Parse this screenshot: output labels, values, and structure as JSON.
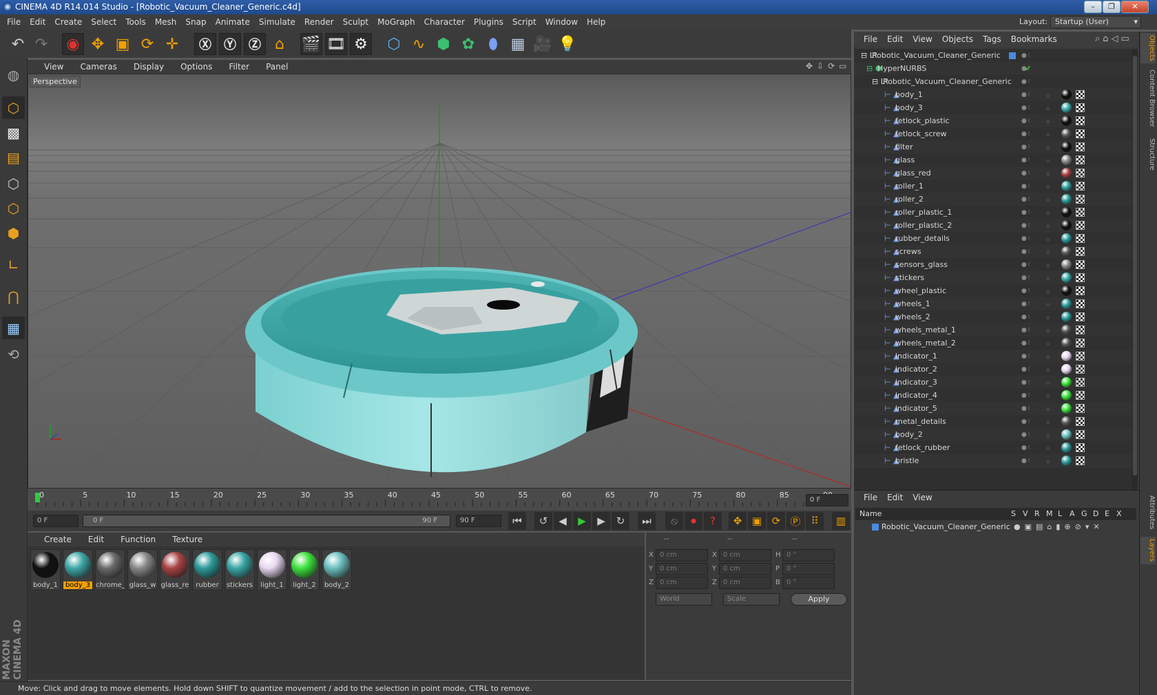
{
  "window": {
    "title": "CINEMA 4D R14.014 Studio - [Robotic_Vacuum_Cleaner_Generic.c4d]"
  },
  "menubar": [
    "File",
    "Edit",
    "Create",
    "Select",
    "Tools",
    "Mesh",
    "Snap",
    "Animate",
    "Simulate",
    "Render",
    "Sculpt",
    "MoGraph",
    "Character",
    "Plugins",
    "Script",
    "Window",
    "Help"
  ],
  "layout": {
    "label": "Layout:",
    "value": "Startup (User)"
  },
  "viewport": {
    "menu": [
      "View",
      "Cameras",
      "Display",
      "Options",
      "Filter",
      "Panel"
    ],
    "label": "Perspective"
  },
  "timeline": {
    "ticks": [
      "0",
      "5",
      "10",
      "15",
      "20",
      "25",
      "30",
      "35",
      "40",
      "45",
      "50",
      "55",
      "60",
      "65",
      "70",
      "75",
      "80",
      "85",
      "90"
    ],
    "current_frame": "0 F",
    "start_field": "0 F",
    "range_start": "0 F",
    "range_end": "90 F",
    "end_field": "90 F"
  },
  "materials": {
    "menu": [
      "Create",
      "Edit",
      "Function",
      "Texture"
    ],
    "items": [
      {
        "label": "body_1",
        "color": "#111111"
      },
      {
        "label": "body_3",
        "color": "#3fa8a8",
        "selected": true
      },
      {
        "label": "chrome_",
        "color": "#6a6a6a"
      },
      {
        "label": "glass_w",
        "color": "#888888"
      },
      {
        "label": "glass_re",
        "color": "#a84444"
      },
      {
        "label": "rubber",
        "color": "#2e9a9a"
      },
      {
        "label": "stickers",
        "color": "#3aa6a6"
      },
      {
        "label": "light_1",
        "color": "#e8d8f0"
      },
      {
        "label": "light_2",
        "color": "#3de23d"
      },
      {
        "label": "body_2",
        "color": "#6cc0c0"
      }
    ]
  },
  "coords": {
    "headers": [
      "--",
      "--",
      "--"
    ],
    "rows": [
      {
        "a": "X",
        "av": "0 cm",
        "b": "X",
        "bv": "0 cm",
        "c": "H",
        "cv": "0 °"
      },
      {
        "a": "Y",
        "av": "0 cm",
        "b": "Y",
        "bv": "0 cm",
        "c": "P",
        "cv": "0 °"
      },
      {
        "a": "Z",
        "av": "0 cm",
        "b": "Z",
        "bv": "0 cm",
        "c": "B",
        "cv": "0 °"
      }
    ],
    "world": "World",
    "scale": "Scale",
    "apply": "Apply"
  },
  "status": "Move: Click and drag to move elements. Hold down SHIFT to quantize movement / add to the selection in point mode, CTRL to remove.",
  "objects": {
    "menu": [
      "File",
      "Edit",
      "View",
      "Objects",
      "Tags",
      "Bookmarks"
    ],
    "root": "Robotic_Vacuum_Cleaner_Generic",
    "hypernurbs": "HyperNURBS",
    "group": "Robotic_Vacuum_Cleaner_Generic",
    "items": [
      {
        "name": "body_1",
        "color": "#111111"
      },
      {
        "name": "body_3",
        "color": "#3fa8a8"
      },
      {
        "name": "fetlock_plastic",
        "color": "#111111"
      },
      {
        "name": "fetlock_screw",
        "color": "#555555"
      },
      {
        "name": "filter",
        "color": "#111111"
      },
      {
        "name": "glass",
        "color": "#888888"
      },
      {
        "name": "glass_red",
        "color": "#a84444"
      },
      {
        "name": "roller_1",
        "color": "#2e9a9a"
      },
      {
        "name": "roller_2",
        "color": "#2e9a9a"
      },
      {
        "name": "roller_plastic_1",
        "color": "#111111"
      },
      {
        "name": "roller_plastic_2",
        "color": "#111111"
      },
      {
        "name": "rubber_details",
        "color": "#2e9a9a"
      },
      {
        "name": "screws",
        "color": "#555555"
      },
      {
        "name": "sensors_glass",
        "color": "#888888"
      },
      {
        "name": "stickers",
        "color": "#3aa6a6"
      },
      {
        "name": "wheel_plastic",
        "color": "#111111"
      },
      {
        "name": "wheels_1",
        "color": "#2e9a9a"
      },
      {
        "name": "wheels_2",
        "color": "#2e9a9a"
      },
      {
        "name": "wheels_metal_1",
        "color": "#555555"
      },
      {
        "name": "wheels_metal_2",
        "color": "#555555"
      },
      {
        "name": "indicator_1",
        "color": "#e8d8f0"
      },
      {
        "name": "indicator_2",
        "color": "#e8d8f0"
      },
      {
        "name": "indicator_3",
        "color": "#3de23d"
      },
      {
        "name": "indicator_4",
        "color": "#3de23d"
      },
      {
        "name": "indicator_5",
        "color": "#3de23d"
      },
      {
        "name": "metal_details",
        "color": "#555555"
      },
      {
        "name": "body_2",
        "color": "#6cc0c0"
      },
      {
        "name": "fetlock_rubber",
        "color": "#2e9a9a"
      },
      {
        "name": "bristle",
        "color": "#2e9a9a"
      }
    ]
  },
  "layers": {
    "menu": [
      "File",
      "Edit",
      "View"
    ],
    "header": {
      "name": "Name",
      "cols": [
        "S",
        "V",
        "R",
        "M",
        "L",
        "A",
        "G",
        "D",
        "E",
        "X"
      ]
    },
    "row": "Robotic_Vacuum_Cleaner_Generic"
  },
  "sidetabs": [
    "Objects",
    "Content Browser",
    "Structure",
    "Attributes",
    "Layers"
  ],
  "brand": "MAXON CINEMA 4D"
}
